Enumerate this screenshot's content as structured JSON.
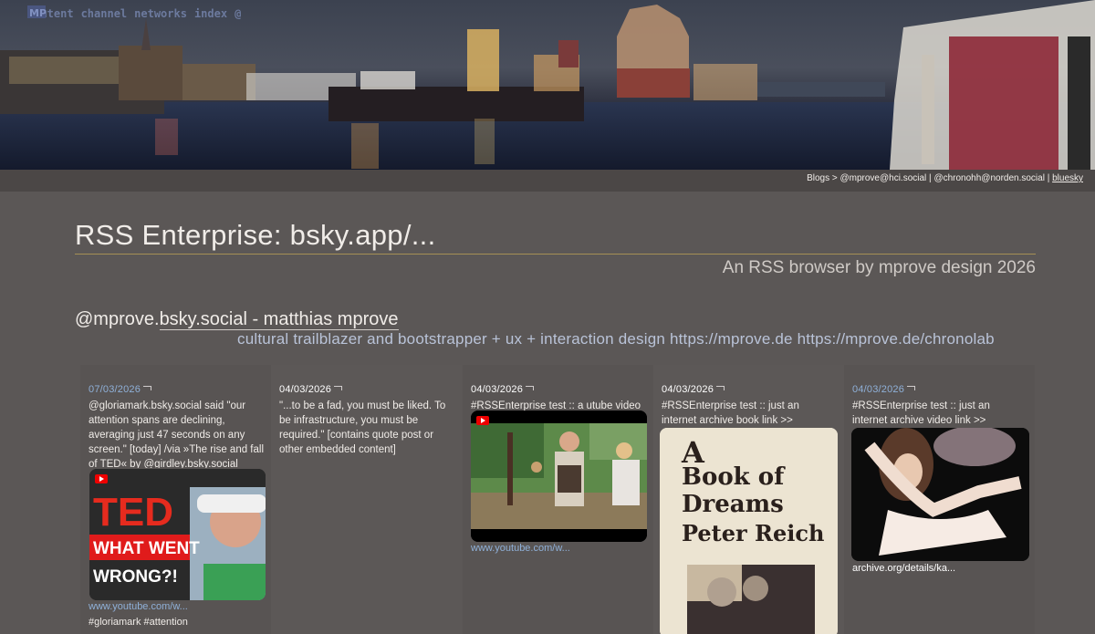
{
  "nav": {
    "logo": "MP",
    "items": [
      "content",
      "channel",
      "networks",
      "index",
      "@"
    ]
  },
  "breadcrumbs": {
    "root": "Blogs",
    "separator": ">",
    "items": [
      "@mprove@hci.social",
      "@chronohh@norden.social",
      "bluesky"
    ],
    "selected": "bluesky"
  },
  "page": {
    "title": "RSS Enterprise: bsky.app/...",
    "subtitle": "An RSS browser by mprove design 2026"
  },
  "profile": {
    "handle_prefix": "@mprove.",
    "handle_link": "bsky.social - matthias mprove",
    "bio": "cultural trailblazer and bootstrapper + ux + interaction design https://mprove.de https://mprove.de/chronolab"
  },
  "posts": [
    {
      "date": "07/03/2026",
      "text": "@gloriamark.bsky.social said \"our attention spans are declining, averaging just 47 seconds on any screen.\" [today] /via »The rise and fall of TED« by @girdley.bsky.social",
      "thumb_title_1": "TED",
      "thumb_title_2": "WHAT WENT",
      "thumb_title_3": "WRONG?!",
      "link": "www.youtube.com/w...",
      "tags": "#gloriamark #attention"
    },
    {
      "date": "04/03/2026",
      "text": "\"...to be a fad, you must be liked. To be infrastructure, you must be required.\" [contains quote post or other embedded content]"
    },
    {
      "date": "04/03/2026",
      "text": "#RSSEnterprise test :: a utube video",
      "link": "www.youtube.com/w..."
    },
    {
      "date": "04/03/2026",
      "text": "#RSSEnterprise test :: just an internet archive book link >>",
      "book_line_1": "A",
      "book_line_2": "Book of",
      "book_line_3": "Dreams",
      "book_line_4": "Peter Reich"
    },
    {
      "date": "04/03/2026",
      "text": "#RSSEnterprise test :: just an internet archive video link >>",
      "link": "archive.org/details/ka..."
    }
  ],
  "colors": {
    "background": "#5b5756",
    "accent_rule": "#a58f55",
    "link": "#8fb0d8",
    "bio": "#b9c3d8"
  }
}
